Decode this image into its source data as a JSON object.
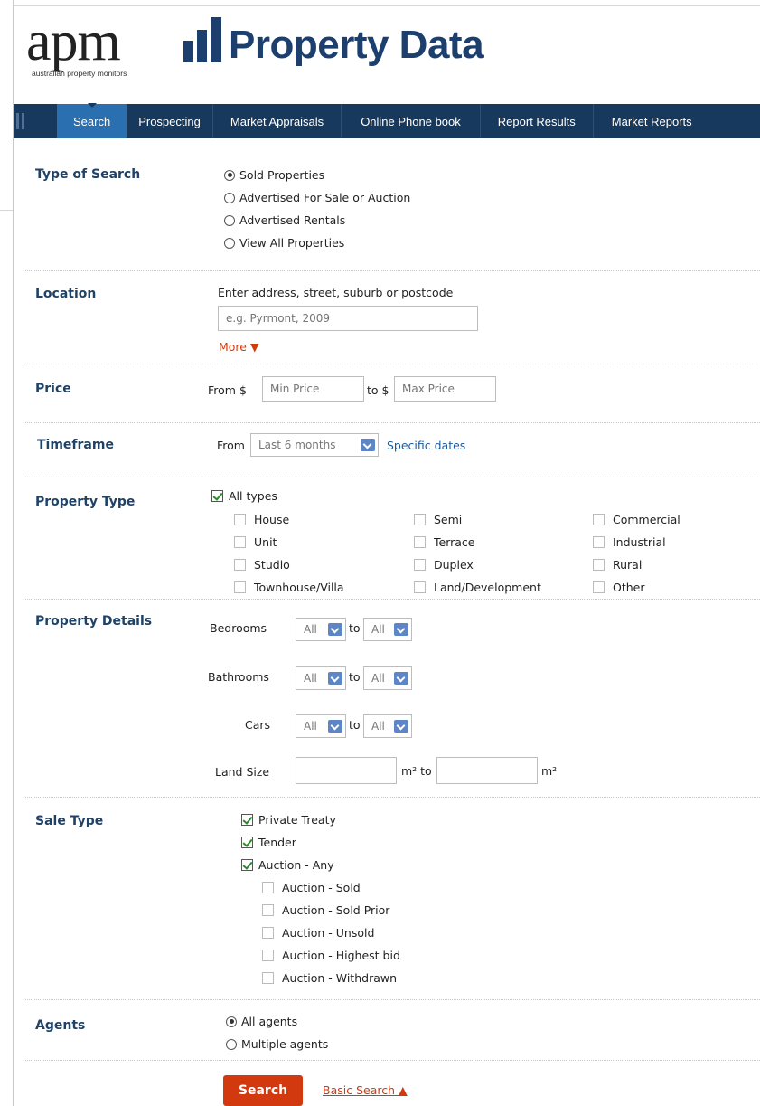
{
  "logo": {
    "apm": "apm",
    "tagline": "australian property monitors",
    "title": "Property Data"
  },
  "nav": {
    "items": [
      {
        "label": "Search"
      },
      {
        "label": "Prospecting"
      },
      {
        "label": "Market Appraisals"
      },
      {
        "label": "Online Phone book"
      },
      {
        "label": "Report Results"
      },
      {
        "label": "Market Reports"
      }
    ],
    "active": "Search"
  },
  "type_of_search": {
    "label": "Type of Search",
    "options": [
      "Sold Properties",
      "Advertised For Sale or Auction",
      "Advertised Rentals",
      "View All Properties"
    ],
    "selected": "Sold Properties"
  },
  "location": {
    "label": "Location",
    "hint": "Enter address, street, suburb or postcode",
    "placeholder": "e.g. Pyrmont, 2009",
    "more": "More ▼"
  },
  "price": {
    "label": "Price",
    "from": "From $",
    "to": "to $",
    "min_placeholder": "Min Price",
    "max_placeholder": "Max Price"
  },
  "timeframe": {
    "label": "Timeframe",
    "from": "From",
    "value": "Last 6 months",
    "specific": "Specific dates"
  },
  "property_type": {
    "label": "Property Type",
    "all_types": "All types",
    "col1": [
      "House",
      "Unit",
      "Studio",
      "Townhouse/Villa"
    ],
    "col2": [
      "Semi",
      "Terrace",
      "Duplex",
      "Land/Development"
    ],
    "col3": [
      "Commercial",
      "Industrial",
      "Rural",
      "Other"
    ]
  },
  "property_details": {
    "label": "Property Details",
    "bedrooms": "Bedrooms",
    "bathrooms": "Bathrooms",
    "cars": "Cars",
    "land_size": "Land Size",
    "all": "All",
    "to": "to",
    "m2_to": "m² to",
    "m2": "m²"
  },
  "sale_type": {
    "label": "Sale Type",
    "main": [
      "Private Treaty",
      "Tender",
      "Auction - Any"
    ],
    "sub": [
      "Auction - Sold",
      "Auction - Sold Prior",
      "Auction - Unsold",
      "Auction - Highest bid",
      "Auction - Withdrawn"
    ]
  },
  "agents": {
    "label": "Agents",
    "options": [
      "All agents",
      "Multiple agents"
    ],
    "selected": "All agents"
  },
  "actions": {
    "search": "Search",
    "basic_search": "Basic Search ▲"
  }
}
